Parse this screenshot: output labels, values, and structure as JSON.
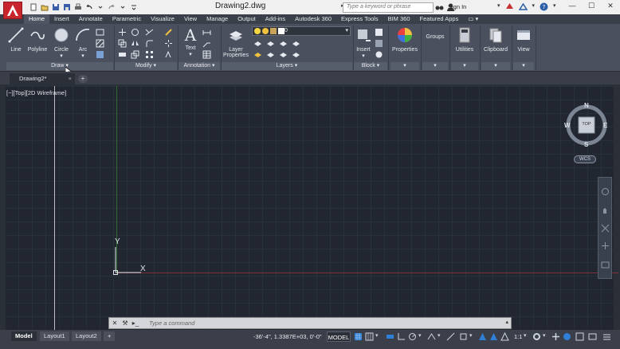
{
  "window": {
    "title": "Drawing2.dwg",
    "search_placeholder": "Type a keyword or phrase",
    "sign_in": "Sign In"
  },
  "ribbon_tabs": [
    "Home",
    "Insert",
    "Annotate",
    "Parametric",
    "Visualize",
    "View",
    "Manage",
    "Output",
    "Add-ins",
    "Autodesk 360",
    "Express Tools",
    "BIM 360",
    "Featured Apps"
  ],
  "ribbon": {
    "draw": {
      "line": "Line",
      "polyline": "Polyline",
      "circle": "Circle",
      "arc": "Arc",
      "panel": "Draw"
    },
    "modify_panel": "Modify",
    "annotation": {
      "text": "Text",
      "panel": "Annotation"
    },
    "layers": {
      "properties_line1": "Layer",
      "properties_line2": "Properties",
      "current_layer": "0",
      "panel": "Layers"
    },
    "block": {
      "insert": "Insert",
      "panel": "Block"
    },
    "properties": "Properties",
    "groups": "Groups",
    "utilities": "Utilities",
    "clipboard": "Clipboard",
    "view": "View"
  },
  "file_tab": "Drawing2*",
  "viewport": {
    "label": "[−][Top][2D Wireframe]",
    "ucs_x": "X",
    "ucs_y": "Y",
    "viewcube": {
      "n": "N",
      "s": "S",
      "e": "E",
      "w": "W",
      "face": "TOP"
    },
    "wcs": "WCS"
  },
  "command": {
    "placeholder": "Type a command"
  },
  "layout_tabs": [
    "Model",
    "Layout1",
    "Layout2"
  ],
  "status": {
    "coordinates": "-36'-4\", 1.3387E+03, 0'-0\"",
    "space": "MODEL",
    "scale": "1:1"
  },
  "colors": {
    "canvas": "#212630",
    "ribbon": "#4a505d",
    "app_button": "#c8262c",
    "x_axis": "#7a3238",
    "y_axis": "#2f6a2f"
  }
}
